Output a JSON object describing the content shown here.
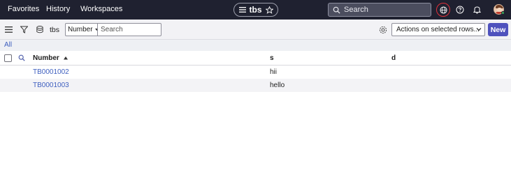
{
  "topnav": {
    "links": [
      "Favorites",
      "History",
      "Workspaces"
    ],
    "center_title": "tbs",
    "search_placeholder": "Search"
  },
  "toolbar": {
    "list_title": "tbs",
    "field_select": "Number",
    "search_placeholder": "Search",
    "actions_label": "Actions on selected rows...",
    "new_label": "New"
  },
  "breadcrumb": {
    "all": "All"
  },
  "table": {
    "columns": [
      "Number",
      "s",
      "d"
    ],
    "sort_column": "Number",
    "sort_direction": "ascending",
    "rows": [
      {
        "number": "TB0001002",
        "s": "hii",
        "d": ""
      },
      {
        "number": "TB0001003",
        "s": "hello",
        "d": ""
      }
    ]
  },
  "colors": {
    "nav_bg": "#1f2130",
    "accent": "#4f52bd",
    "link": "#3e5fbf",
    "highlight_ring": "#e0303a"
  }
}
